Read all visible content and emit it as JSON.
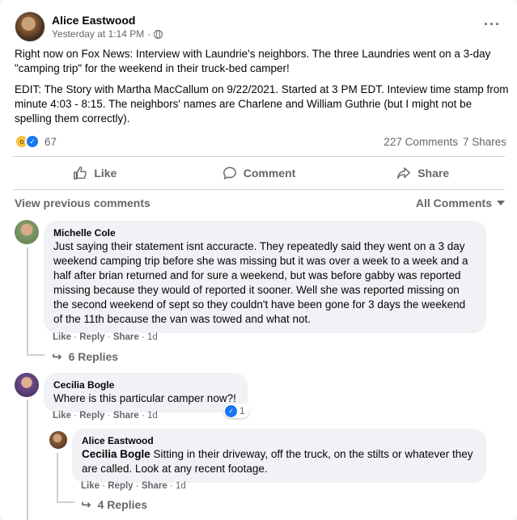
{
  "post": {
    "author": "Alice Eastwood",
    "timestamp": "Yesterday at 1:14 PM",
    "separator": "·",
    "more_label": "···",
    "body_p1": "Right now on Fox News: Interview with Laundrie's neighbors. The three Laundries went on a 3-day \"camping trip\" for the weekend in their truck-bed camper!",
    "body_p2": "EDIT: The Story with Martha MacCallum on 9/22/2021. Started at 3 PM EDT. Inteview time stamp from minute 4:03 - 8:15. The neighbors' names are Charlene and William Guthrie (but I might not be spelling them correctly).",
    "reaction_count": "67",
    "comments_count": "227 Comments",
    "shares_count": "7 Shares"
  },
  "actions": {
    "like": "Like",
    "comment": "Comment",
    "share": "Share"
  },
  "comments_bar": {
    "view_previous": "View previous comments",
    "sort": "All Comments"
  },
  "comments": [
    {
      "name": "Michelle Cole",
      "text": "Just saying their statement isnt accuracte. They repeatedly said they went on a 3 day weekend camping trip before she was missing but it was over a week to a week and a half after brian returned and for sure a weekend, but was before gabby was reported missing because they would of reported it sooner. Well she was reported missing on the second weekend of sept so they couldn't have been gone for 3 days the weekend of the 11th because the van was towed and what not.",
      "like": "Like",
      "reply": "Reply",
      "share": "Share",
      "age": "1d",
      "replies": "6 Replies"
    },
    {
      "name": "Cecilia Bogle",
      "text": "Where is this particular camper now?!",
      "like": "Like",
      "reply": "Reply",
      "share": "Share",
      "age": "1d",
      "like_count": "1"
    }
  ],
  "reply": {
    "name": "Alice Eastwood",
    "mention": "Cecilia Bogle",
    "text": " Sitting in their driveway, off the truck, on the stilts or whatever they are called. Look at any recent footage.",
    "like": "Like",
    "reply": "Reply",
    "share": "Share",
    "age": "1d",
    "replies": "4 Replies"
  },
  "colors": {
    "accent": "#1877f2",
    "secondary_text": "#65676b",
    "bubble": "#f0f2f5"
  }
}
